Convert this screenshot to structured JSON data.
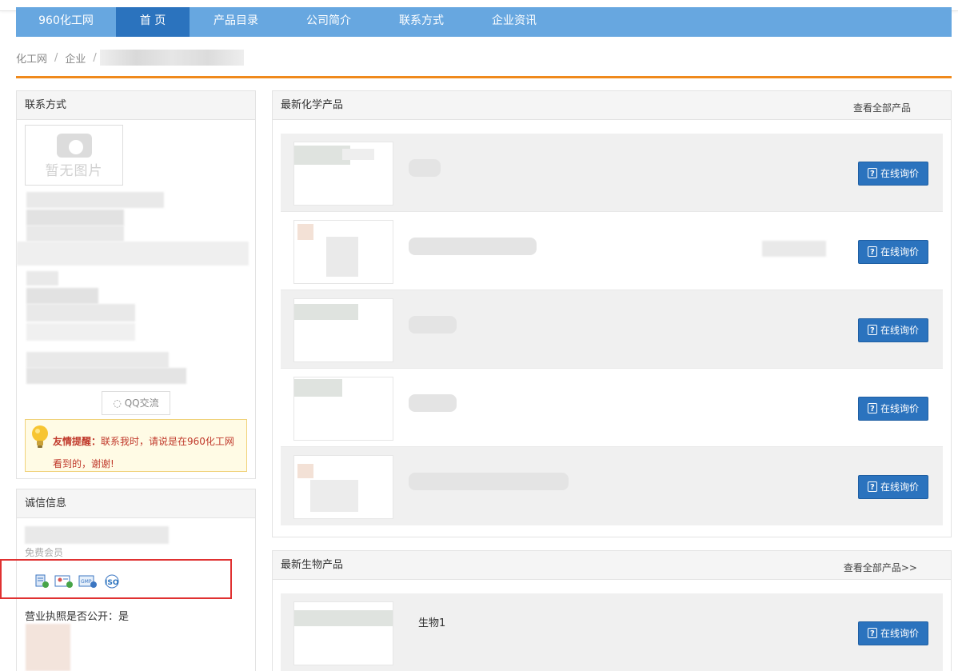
{
  "nav": {
    "brand": "960化工网",
    "items": [
      "首 页",
      "产品目录",
      "公司简介",
      "联系方式",
      "企业资讯"
    ]
  },
  "breadcrumb": [
    "化工网",
    "企业"
  ],
  "contact": {
    "title": "联系方式",
    "no_photo": "暂无图片",
    "qq_label": "QQ交流",
    "tip_bold": "友情提醒：",
    "tip_text": "联系我时，请说是在960化工网看到的，谢谢!"
  },
  "credit": {
    "title": "诚信信息",
    "member": "免费会员",
    "license": "营业执照是否公开：是",
    "cert_icons": [
      "license-cert-icon",
      "id-cert-icon",
      "gmp-cert-icon",
      "iso-cert-icon"
    ]
  },
  "chem": {
    "title": "最新化学产品",
    "more": "查看全部产品",
    "ask_label": "在线询价",
    "row_count": 5
  },
  "bio": {
    "title": "最新生物产品",
    "more": "查看全部产品>>",
    "first_product": "生物1",
    "ask_label": "在线询价"
  },
  "colors": {
    "nav": "#67a7e0",
    "nav_active": "#2b73be",
    "accent_line": "#f08a1c",
    "button": "#2b73be",
    "alert": "#e03131"
  }
}
